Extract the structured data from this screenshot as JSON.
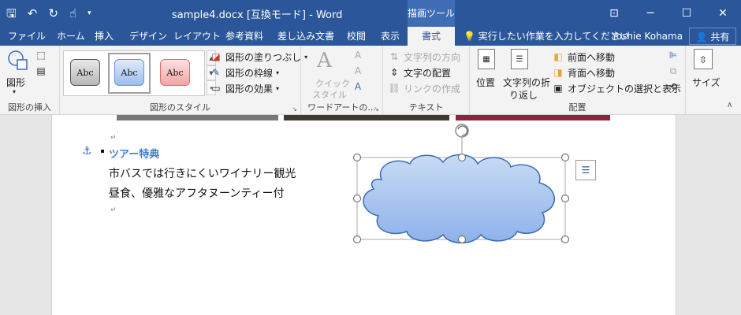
{
  "titlebar": {
    "doc_title": "sample4.docx [互換モード] - Word",
    "context_tab_header": "描画ツール",
    "qat_icons": [
      "save-icon",
      "undo-icon",
      "redo-icon",
      "touch-mode-icon",
      "customize-qat-icon"
    ],
    "window_controls": [
      "ribbon-display-icon",
      "minimize-icon",
      "maximize-icon",
      "close-icon"
    ]
  },
  "tabs": [
    "ファイル",
    "ホーム",
    "挿入",
    "デザイン",
    "レイアウト",
    "参考資料",
    "差し込み文書",
    "校閲",
    "表示",
    "書式"
  ],
  "active_tab": "書式",
  "tellme": "実行したい作業を入力してください",
  "user": "Yoshie Kohama",
  "share": "共有",
  "ribbon": {
    "insert_shapes": {
      "shape_label": "図形",
      "group_label": "図形の挿入"
    },
    "shape_styles": {
      "abc": "Abc",
      "fill": "図形の塗りつぶし",
      "outline": "図形の枠線",
      "effects": "図形の効果",
      "group_label": "図形のスタイル"
    },
    "wordart": {
      "quick_style_1": "クイック",
      "quick_style_2": "スタイル",
      "group_label": "ワードアートの..."
    },
    "text": {
      "direction": "文字列の方向",
      "align": "文字の配置",
      "link": "リンクの作成",
      "group_label": "テキスト"
    },
    "arrange": {
      "position": "位置",
      "wrap_1": "文字列の折",
      "wrap_2": "り返し",
      "bring_forward": "前面へ移動",
      "send_backward": "背面へ移動",
      "selection_pane": "オブジェクトの選択と表示",
      "group_label": "配置"
    },
    "size": {
      "label": "サイズ"
    }
  },
  "document": {
    "heading": "ツアー特典",
    "line1": "市バスでは行きにくいワイナリー観光",
    "line2": "昼食、優雅なアフタヌーンティー付",
    "para_mark": "↵"
  },
  "colors": {
    "title_bar": "#2b579a",
    "context_tab": "#3e6db5",
    "heading_blue": "#3d7fd0",
    "cloud_fill_top": "#c9dbf5",
    "cloud_fill_bottom": "#8db2ea",
    "cloud_stroke": "#3d6bb5"
  }
}
